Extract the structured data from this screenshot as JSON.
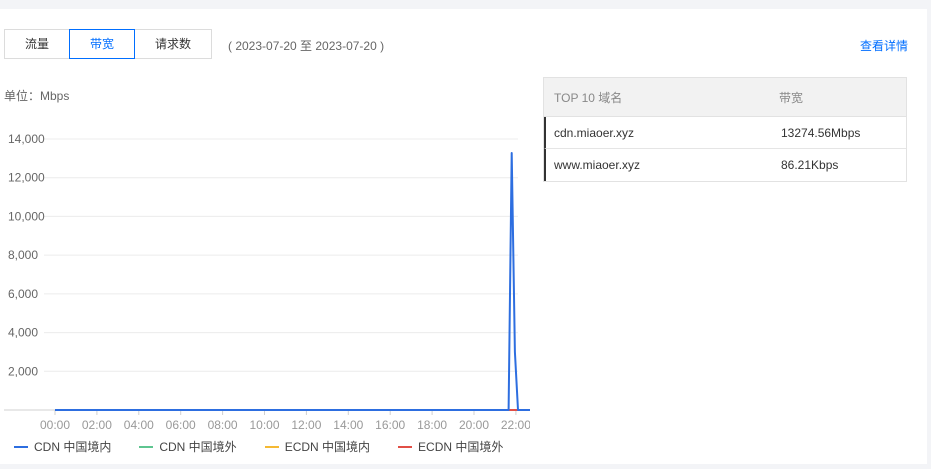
{
  "tabs": [
    {
      "label": "流量",
      "active": false
    },
    {
      "label": "带宽",
      "active": true
    },
    {
      "label": "请求数",
      "active": false
    }
  ],
  "date_range": "( 2023-07-20 至 2023-07-20 )",
  "detail_link": "查看详情",
  "unit_label": "单位：Mbps",
  "top_table": {
    "headers": [
      "TOP 10 域名",
      "带宽"
    ],
    "rows": [
      {
        "domain": "cdn.miaoer.xyz",
        "value": "13274.56Mbps"
      },
      {
        "domain": "www.miaoer.xyz",
        "value": "86.21Kbps"
      }
    ]
  },
  "chart_data": {
    "type": "line",
    "y_ticks": [
      "2,000",
      "4,000",
      "6,000",
      "8,000",
      "10,000",
      "12,000",
      "14,000"
    ],
    "y_tick_values": [
      2000,
      4000,
      6000,
      8000,
      10000,
      12000,
      14000
    ],
    "x_ticks": [
      "00:00",
      "02:00",
      "04:00",
      "06:00",
      "08:00",
      "10:00",
      "12:00",
      "14:00",
      "16:00",
      "18:00",
      "20:00",
      "22:00"
    ],
    "x_tick_hours": [
      0,
      2,
      4,
      6,
      8,
      10,
      12,
      14,
      16,
      18,
      20,
      22
    ],
    "ylim": [
      0,
      14000
    ],
    "series": [
      {
        "name": "CDN 中国境内",
        "color": "#2d6ee0",
        "x": [
          0,
          21.5,
          21.65,
          21.8,
          21.95,
          22.1,
          22.25,
          22.4,
          23.9
        ],
        "y": [
          0,
          0,
          0,
          13274.56,
          3000,
          0,
          0,
          0,
          0
        ]
      },
      {
        "name": "CDN 中国境外",
        "color": "#5ec590",
        "x": [
          0,
          23.9
        ],
        "y": [
          0,
          0
        ]
      },
      {
        "name": "ECDN 中国境内",
        "color": "#f5b933",
        "x": [
          0,
          23.9
        ],
        "y": [
          0,
          0
        ]
      },
      {
        "name": "ECDN 中国境外",
        "color": "#e14f46",
        "x": [
          0,
          23.9
        ],
        "y": [
          0,
          0
        ]
      }
    ]
  }
}
